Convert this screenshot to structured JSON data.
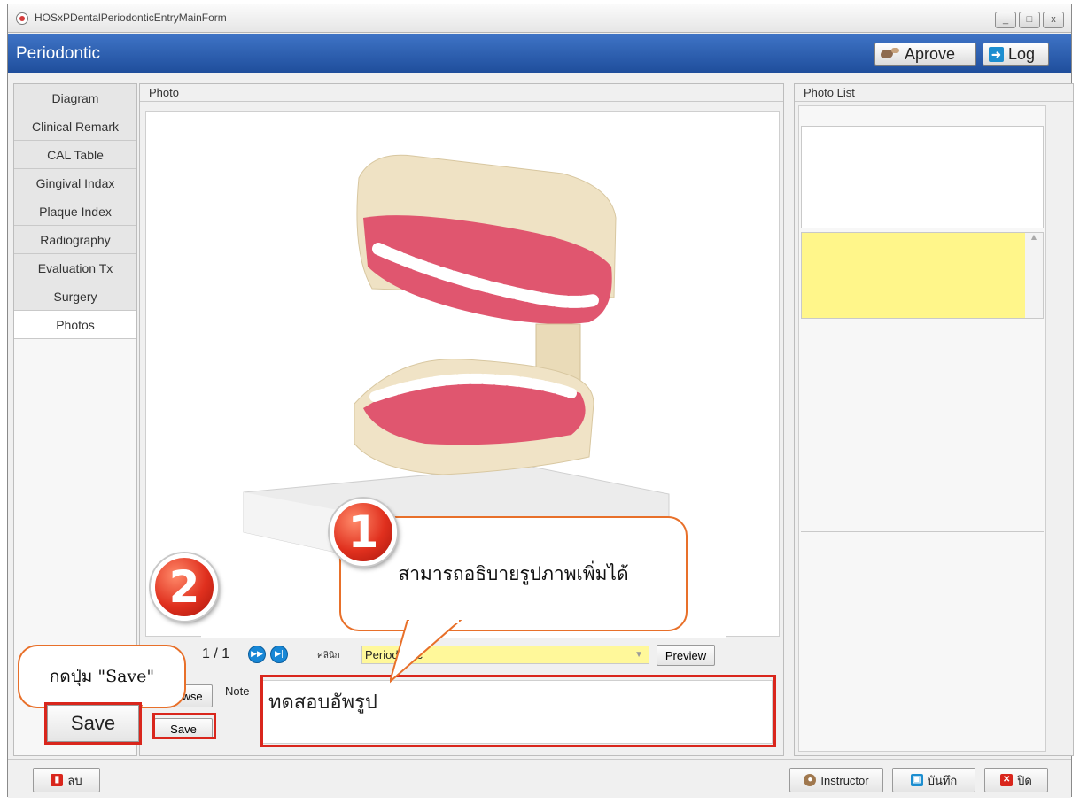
{
  "window": {
    "title": "HOSxPDentalPeriodonticEntryMainForm",
    "controls": [
      "_",
      "□",
      "x"
    ]
  },
  "header": {
    "title": "Periodontic",
    "approve_label": "Aprove",
    "log_label": "Log"
  },
  "sidebar": {
    "items": [
      {
        "label": "Diagram",
        "active": false
      },
      {
        "label": "Clinical Remark",
        "active": false
      },
      {
        "label": "CAL Table",
        "active": false
      },
      {
        "label": "Gingival Indax",
        "active": false
      },
      {
        "label": "Plaque Index",
        "active": false
      },
      {
        "label": "Radiography",
        "active": false
      },
      {
        "label": "Evaluation Tx",
        "active": false
      },
      {
        "label": "Surgery",
        "active": false
      },
      {
        "label": "Photos",
        "active": true
      }
    ]
  },
  "photo": {
    "header": "Photo",
    "pager": "1 / 1",
    "clinic_label": "คลินิก",
    "clinic_value": "Periodontic",
    "preview_label": "Preview",
    "browse_label": "Browse",
    "note_label": "Note",
    "note_value": "ทดสอบอัพรูป",
    "save_label": "Save"
  },
  "photo_list": {
    "header": "Photo List"
  },
  "footer": {
    "delete_label": "ลบ",
    "instructor_label": "Instructor",
    "save_label": "บันทึก",
    "close_label": "ปิด"
  },
  "annotations": {
    "callout1": "สามารถอธิบายรูปภาพเพิ่มได้",
    "callout2": "กดปุ่ม \"Save\"",
    "badge1": "1",
    "badge2": "2",
    "big_save": "Save"
  },
  "colors": {
    "header_blue": "#2a5daf",
    "highlight_yellow": "#fff68a",
    "annotation_red": "#d9261c",
    "callout_border": "#e8702a"
  }
}
